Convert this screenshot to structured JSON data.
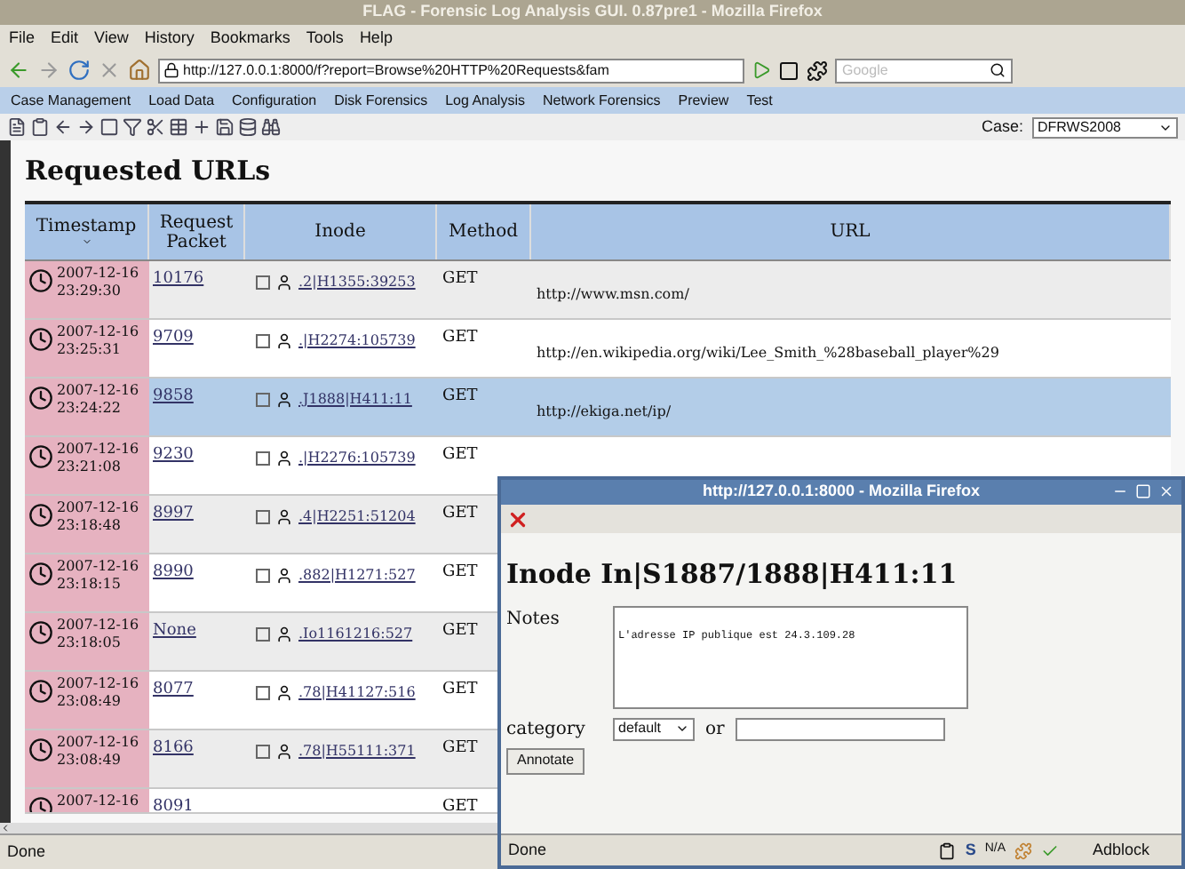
{
  "window": {
    "title": "FLAG - Forensic Log Analysis GUI. 0.87pre1 - Mozilla Firefox"
  },
  "menu": [
    "File",
    "Edit",
    "View",
    "History",
    "Bookmarks",
    "Tools",
    "Help"
  ],
  "address": {
    "value": "http://127.0.0.1:8000/f?report=Browse%20HTTP%20Requests&fam"
  },
  "search": {
    "placeholder": "Google"
  },
  "app_menu": [
    "Case Management",
    "Load Data",
    "Configuration",
    "Disk Forensics",
    "Log Analysis",
    "Network Forensics",
    "Preview",
    "Test"
  ],
  "case": {
    "label": "Case:",
    "value": "DFRWS2008"
  },
  "heading": "Requested URLs",
  "table": {
    "columns": [
      "Timestamp",
      "Request Packet",
      "Inode",
      "Method",
      "URL"
    ],
    "rows": [
      {
        "date": "2007-12-16",
        "time": "23:29:30",
        "packet": "10176",
        "inode": ".2|H1355:39253",
        "method": "GET",
        "url": "http://www.msn.com/",
        "selected": false,
        "checked": false
      },
      {
        "date": "2007-12-16",
        "time": "23:25:31",
        "packet": "9709",
        "inode": ".|H2274:105739",
        "method": "GET",
        "url": "http://en.wikipedia.org/wiki/Lee_Smith_%28baseball_player%29",
        "selected": false,
        "checked": false
      },
      {
        "date": "2007-12-16",
        "time": "23:24:22",
        "packet": "9858",
        "inode": ".J1888|H411:11",
        "method": "GET",
        "url": "http://ekiga.net/ip/",
        "selected": true,
        "checked": false
      },
      {
        "date": "2007-12-16",
        "time": "23:21:08",
        "packet": "9230",
        "inode": ".|H2276:105739",
        "method": "GET",
        "selected": false,
        "checked": false
      },
      {
        "date": "2007-12-16",
        "time": "23:18:48",
        "packet": "8997",
        "inode": ".4|H2251:51204",
        "method": "GET",
        "selected": false,
        "checked": false
      },
      {
        "date": "2007-12-16",
        "time": "23:18:15",
        "packet": "8990",
        "inode": ".882|H1271:527",
        "method": "GET",
        "selected": false,
        "checked": false
      },
      {
        "date": "2007-12-16",
        "time": "23:18:05",
        "packet": "None",
        "inode": ".Io1161216:527",
        "method": "GET",
        "selected": false,
        "checked": false
      },
      {
        "date": "2007-12-16",
        "time": "23:08:49",
        "packet": "8077",
        "inode": ".78|H41127:516",
        "method": "GET",
        "selected": false,
        "checked": false
      },
      {
        "date": "2007-12-16",
        "time": "23:08:49",
        "packet": "8166",
        "inode": ".78|H55111:371",
        "method": "GET",
        "selected": false,
        "checked": false
      },
      {
        "date": "2007-12-16",
        "packet": "8091",
        "method": "GET",
        "selected": false
      }
    ]
  },
  "status_bar": "Done",
  "popup": {
    "title": "http://127.0.0.1:8000 - Mozilla Firefox",
    "heading": "Inode In|S1887/1888|H411:11",
    "notes_label": "Notes",
    "notes": "L'adresse IP publique est 24.3.109.28",
    "category_label": "category",
    "category_value": "default",
    "or": "or",
    "button": "Annotate",
    "status": "Done",
    "status_items": [
      "S",
      "N/A",
      "Adblock"
    ]
  }
}
